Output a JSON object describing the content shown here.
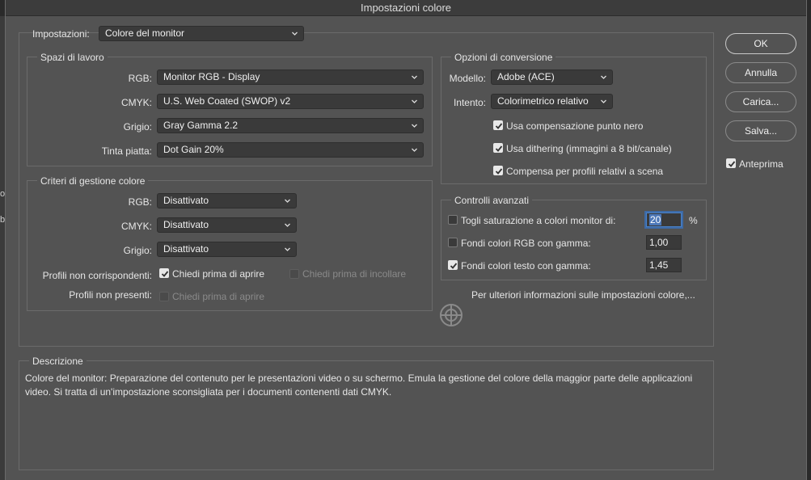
{
  "window": {
    "title": "Impostazioni colore"
  },
  "settings": {
    "label": "Impostazioni:",
    "value": "Colore del monitor"
  },
  "working_spaces": {
    "title": "Spazi di lavoro",
    "rgb": {
      "label": "RGB:",
      "value": "Monitor RGB - Display"
    },
    "cmyk": {
      "label": "CMYK:",
      "value": "U.S. Web Coated (SWOP) v2"
    },
    "gray": {
      "label": "Grigio:",
      "value": "Gray Gamma 2.2"
    },
    "spot": {
      "label": "Tinta piatta:",
      "value": "Dot Gain 20%"
    }
  },
  "policies": {
    "title": "Criteri di gestione colore",
    "rgb": {
      "label": "RGB:",
      "value": "Disattivato"
    },
    "cmyk": {
      "label": "CMYK:",
      "value": "Disattivato"
    },
    "gray": {
      "label": "Grigio:",
      "value": "Disattivato"
    },
    "mismatch": {
      "label": "Profili non corrispondenti:",
      "ask_open": "Chiedi prima di aprire",
      "ask_open_checked": true,
      "ask_paste": "Chiedi prima di incollare",
      "ask_paste_checked": false
    },
    "missing": {
      "label": "Profili non presenti:",
      "ask_open": "Chiedi prima di aprire",
      "ask_open_checked": false
    }
  },
  "conversion": {
    "title": "Opzioni di conversione",
    "engine": {
      "label": "Modello:",
      "value": "Adobe (ACE)"
    },
    "intent": {
      "label": "Intento:",
      "value": "Colorimetrico relativo"
    },
    "black_point": {
      "label": "Usa compensazione punto nero",
      "checked": true
    },
    "dither": {
      "label": "Usa dithering (immagini a 8 bit/canale)",
      "checked": true
    },
    "scene": {
      "label": "Compensa per profili relativi a scena",
      "checked": true
    }
  },
  "advanced": {
    "title": "Controlli avanzati",
    "desaturate": {
      "label": "Togli saturazione a colori monitor di:",
      "checked": false,
      "value": "20",
      "unit": "%"
    },
    "blend_rgb": {
      "label": "Fondi colori RGB con gamma:",
      "checked": false,
      "value": "1,00"
    },
    "blend_text": {
      "label": "Fondi colori testo con gamma:",
      "checked": true,
      "value": "1,45"
    }
  },
  "more_info": "Per ulteriori informazioni sulle impostazioni colore,...",
  "buttons": {
    "ok": "OK",
    "cancel": "Annulla",
    "load": "Carica...",
    "save": "Salva..."
  },
  "preview": {
    "label": "Anteprima",
    "checked": true
  },
  "description": {
    "title": "Descrizione",
    "text": "Colore del monitor:  Preparazione del contenuto per le presentazioni video o su schermo. Emula la gestione del colore della maggior parte delle applicazioni video. Si tratta di un'impostazione sconsigliata per i documenti contenenti dati CMYK."
  },
  "background": {
    "left_text_1": "og",
    "left_text_2": "b"
  },
  "colors": {
    "dialog": "#535353",
    "field": "#3a3a3a",
    "focus": "#4a82c8"
  }
}
